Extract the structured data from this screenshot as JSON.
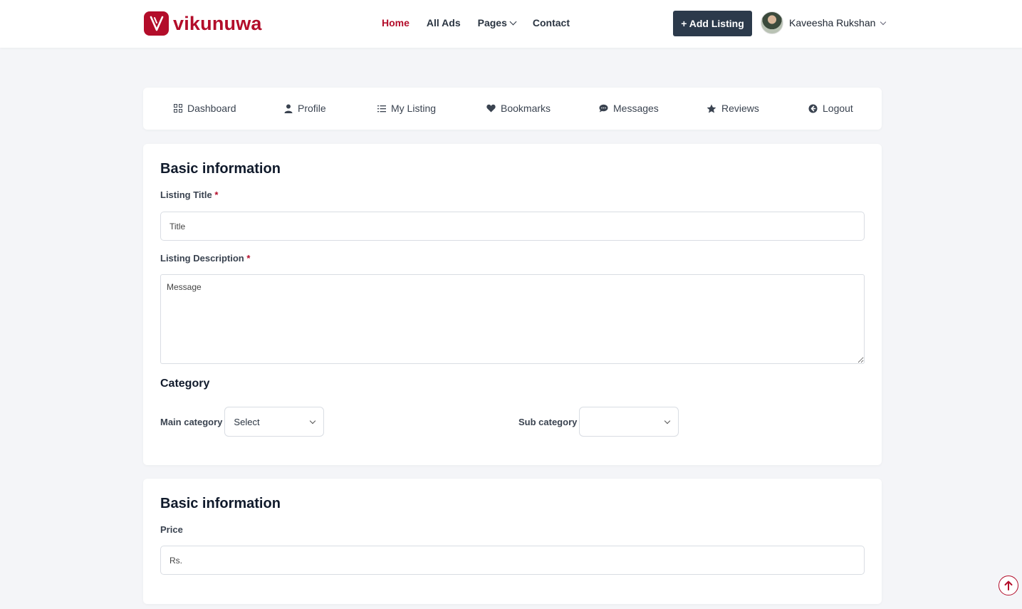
{
  "header": {
    "logo_text": "vikunuwa",
    "nav": [
      {
        "label": "Home",
        "active": true
      },
      {
        "label": "All Ads",
        "active": false
      },
      {
        "label": "Pages",
        "active": false,
        "has_dropdown": true
      },
      {
        "label": "Contact",
        "active": false
      }
    ],
    "add_listing_label": "+ Add Listing",
    "user_name": "Kaveesha Rukshan"
  },
  "tabs": [
    {
      "label": "Dashboard",
      "icon": "grid-icon"
    },
    {
      "label": "Profile",
      "icon": "user-icon"
    },
    {
      "label": "My Listing",
      "icon": "list-icon"
    },
    {
      "label": "Bookmarks",
      "icon": "heart-icon"
    },
    {
      "label": "Messages",
      "icon": "chat-icon"
    },
    {
      "label": "Reviews",
      "icon": "star-icon"
    },
    {
      "label": "Logout",
      "icon": "logout-icon"
    }
  ],
  "basic_info": {
    "title": "Basic information",
    "listing_title_label": "Listing Title",
    "listing_title_placeholder": "Title",
    "description_label": "Listing Description",
    "description_placeholder": "Message",
    "required_mark": "*",
    "category_title": "Category",
    "main_category_label": "Main category",
    "main_category_value": "Select",
    "sub_category_label": "Sub category",
    "sub_category_value": ""
  },
  "pricing": {
    "title": "Basic information",
    "price_label": "Price",
    "price_placeholder": "Rs."
  },
  "colors": {
    "brand": "#b30d2a",
    "dark_button": "#2c3a4b",
    "page_bg": "#f4f5f8"
  }
}
